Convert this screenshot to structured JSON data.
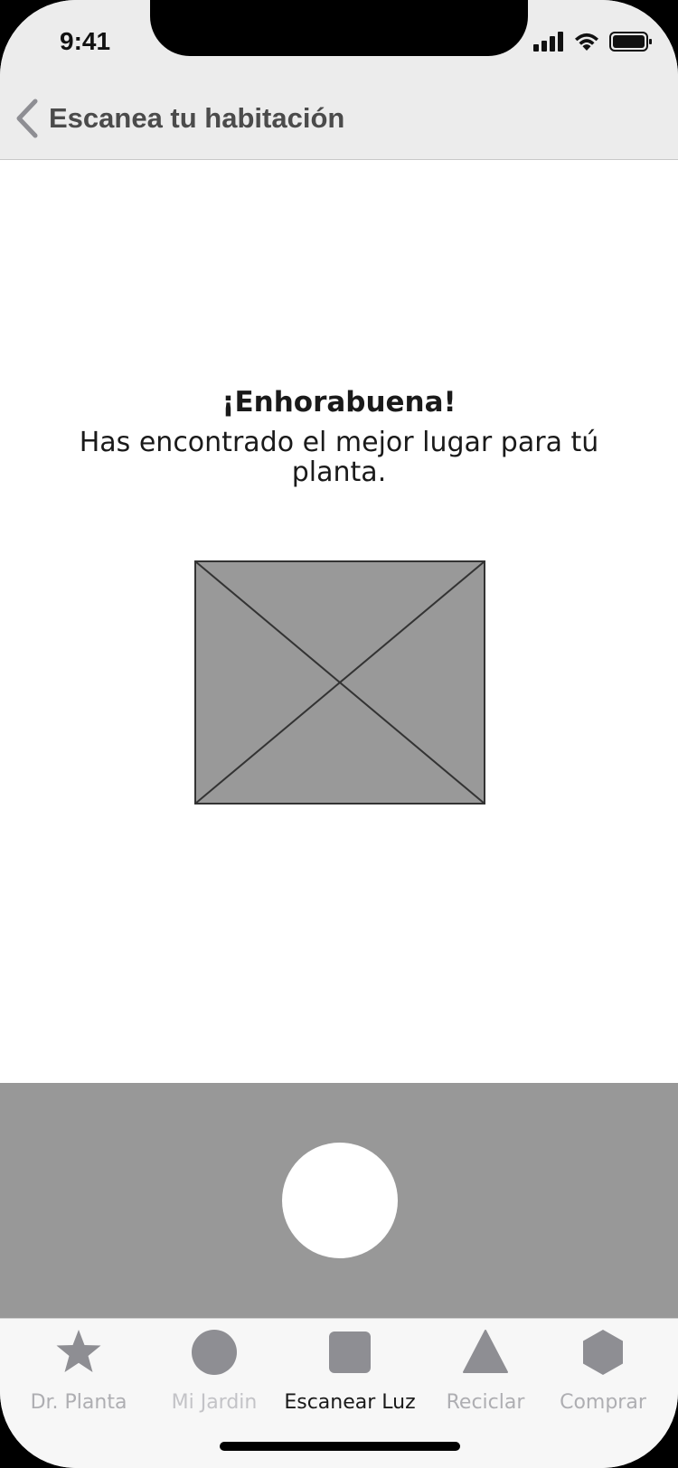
{
  "status_bar": {
    "time": "9:41"
  },
  "nav": {
    "back_icon": "chevron-left-icon",
    "title": "Escanea tu habitación"
  },
  "content": {
    "title": "¡Enhorabuena!",
    "message": "Has encontrado el mejor lugar para tú planta."
  },
  "tabs": [
    {
      "label": "Dr. Planta",
      "icon": "star-icon",
      "active": false
    },
    {
      "label": "Mi Jardin",
      "icon": "circle-icon",
      "active": false
    },
    {
      "label": "Escanear Luz",
      "icon": "square-icon",
      "active": true
    },
    {
      "label": "Reciclar",
      "icon": "triangle-icon",
      "active": false
    },
    {
      "label": "Comprar",
      "icon": "hexagon-icon",
      "active": false
    }
  ],
  "colors": {
    "bar_background": "#ececec",
    "camera_panel": "#989898",
    "placeholder_fill": "#999999",
    "tab_inactive": "#aeaeb2",
    "tab_active": "#1a1a1a"
  }
}
